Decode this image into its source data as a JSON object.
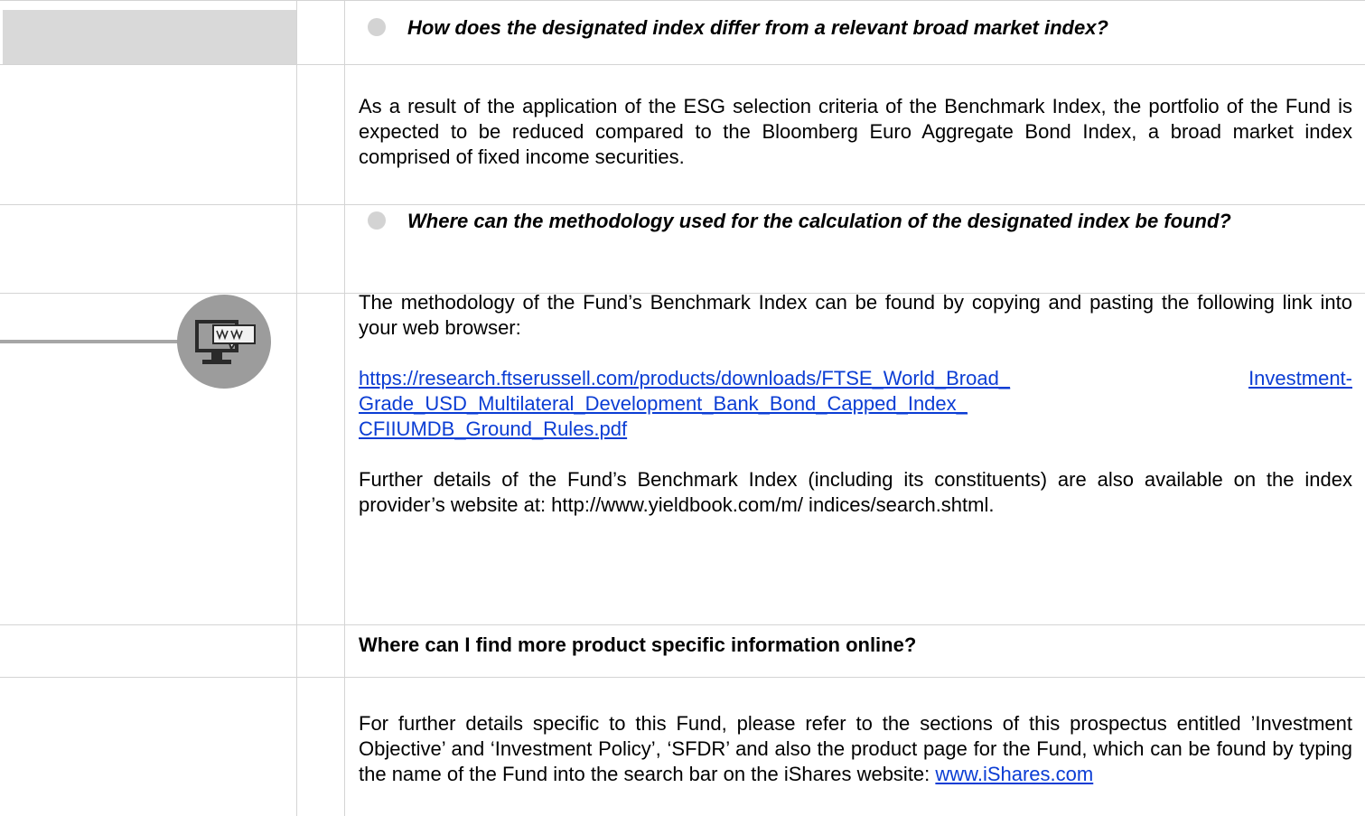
{
  "q1": "How does the designated index differ from a relevant broad market index?",
  "a1": "As a result of the application of the ESG selection criteria of the Benchmark Index, the portfolio of the Fund is expected to be reduced compared to the Bloomberg Euro Aggregate Bond Index, a broad market index comprised of fixed income securities.",
  "q2": "Where can the methodology used for the calculation of the designated index be found?",
  "a2_intro": "The methodology of the Fund’s Benchmark Index can be found by copying and pasting the following link into your web browser:",
  "a2_link": "https://research.ftserussell.com/products/downloads/FTSE_World_Broad_Investment-Grade_USD_Multilateral_Development_Bank_Bond_Capped_Index_CFIIUMDB_Ground_Rules.pdf",
  "a2_link_l1a": "https://research.ftserussell.com/products/downloads/FTSE_World_Broad_",
  "a2_link_l1b": "Investment-",
  "a2_link_l2": "Grade_USD_Multilateral_Development_Bank_Bond_Capped_Index_",
  "a2_link_l3": "CFIIUMDB_Ground_Rules.pdf",
  "a2_more": "Further details of the Fund’s Benchmark Index (including its constituents) are also available on the index provider’s website at: http://www.yieldbook.com/m/ indices/search.shtml.",
  "q3": "Where can I find more product specific information online?",
  "a3_text": "For further details specific to this Fund, please refer to the sections of this prospectus entitled ’Investment Objective’ and ‘Investment Policy’, ‘SFDR’ and also the product page for the Fund, which can be found by typing the name of the Fund into the search bar on the iShares website: ",
  "a3_link": "www.iShares.com",
  "icon_name": "web-computer-chat-icon",
  "colors": {
    "link": "#0b3dd4",
    "shade": "#d9d9d9",
    "icon_bg": "#9c9c9c"
  }
}
